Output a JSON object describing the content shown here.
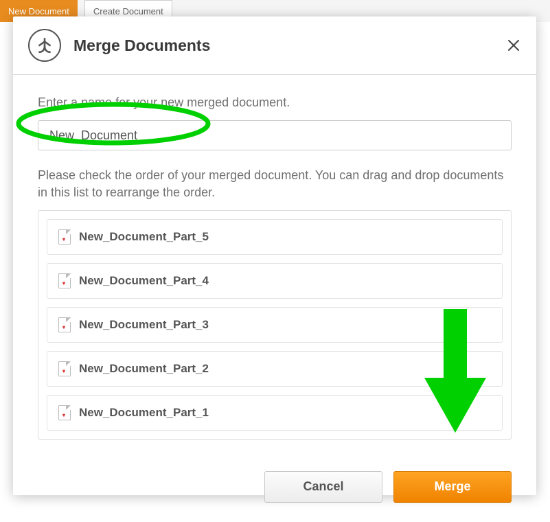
{
  "background": {
    "new_document_btn": "New Document",
    "second_btn": "Create Document"
  },
  "dialog": {
    "title": "Merge Documents",
    "name_label": "Enter a name for your new merged document.",
    "name_value": "New_Document",
    "order_hint": "Please check the order of your merged document. You can drag and drop documents in this list to rearrange the order.",
    "items": [
      {
        "label": "New_Document_Part_5"
      },
      {
        "label": "New_Document_Part_4"
      },
      {
        "label": "New_Document_Part_3"
      },
      {
        "label": "New_Document_Part_2"
      },
      {
        "label": "New_Document_Part_1"
      }
    ],
    "cancel": "Cancel",
    "merge": "Merge"
  },
  "annotation": {
    "oval_color": "#00d000",
    "arrow_color": "#00d000"
  }
}
